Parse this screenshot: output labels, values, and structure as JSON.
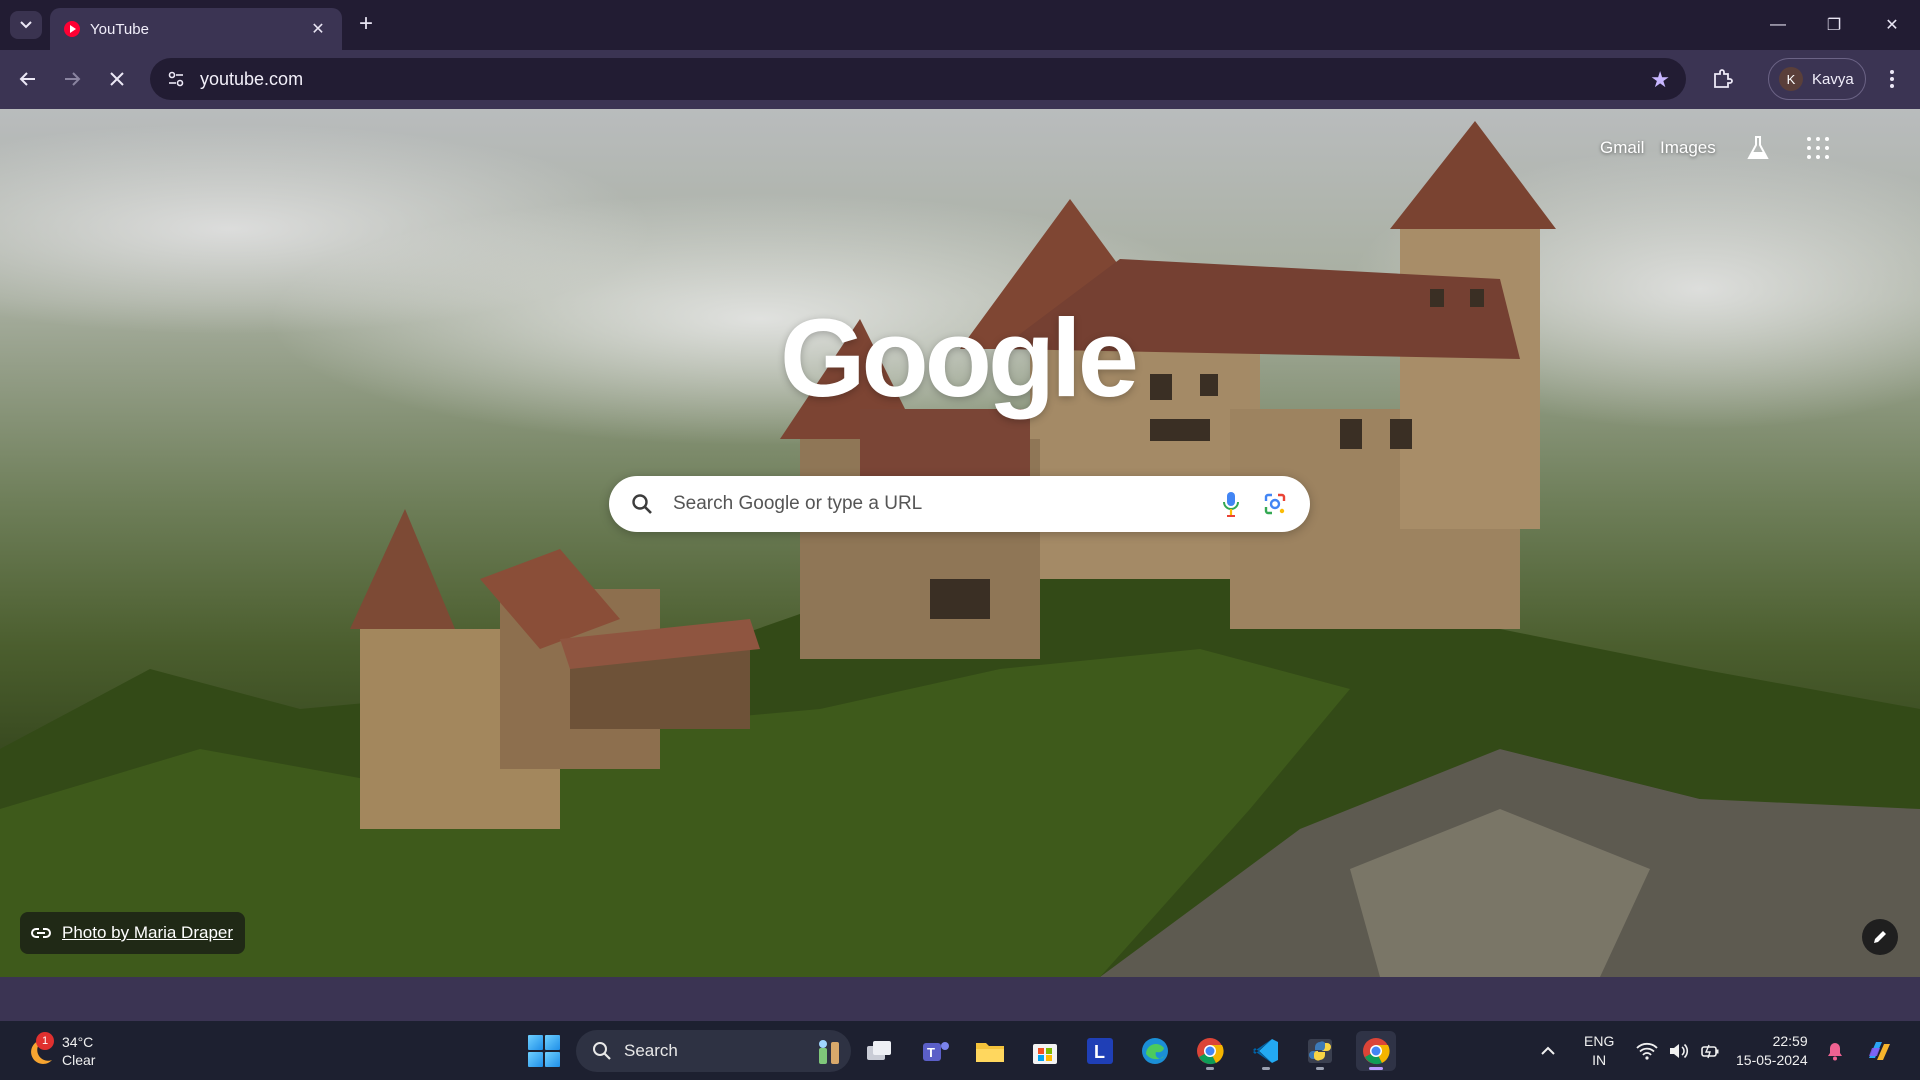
{
  "browser": {
    "tab": {
      "title": "YouTube",
      "close": "✕"
    },
    "new_tab": "+",
    "window": {
      "minimize": "—",
      "restore": "❐",
      "close": "✕"
    },
    "toolbar": {
      "url": "youtube.com",
      "profile_initial": "K",
      "profile_name": "Kavya"
    }
  },
  "ntp": {
    "links": {
      "gmail": "Gmail",
      "images": "Images"
    },
    "logo": "Google",
    "search": {
      "placeholder": "Search Google or type a URL"
    },
    "attribution": "Photo by Maria Draper",
    "colors": {
      "logo": "#ffffff",
      "star": "#c8b6ff",
      "accent": "#b99cff"
    }
  },
  "taskbar": {
    "weather": {
      "temp": "34°C",
      "condition": "Clear",
      "badge": "1"
    },
    "search_label": "Search",
    "apps": [
      "task-view-icon",
      "teams-icon",
      "file-explorer-icon",
      "microsoft-store-icon",
      "l-app-icon",
      "edge-icon",
      "chrome-icon",
      "vscode-icon",
      "python-icon",
      "chrome-icon"
    ],
    "tray": {
      "lang_line1": "ENG",
      "lang_line2": "IN",
      "time": "22:59",
      "date": "15-05-2024"
    }
  }
}
